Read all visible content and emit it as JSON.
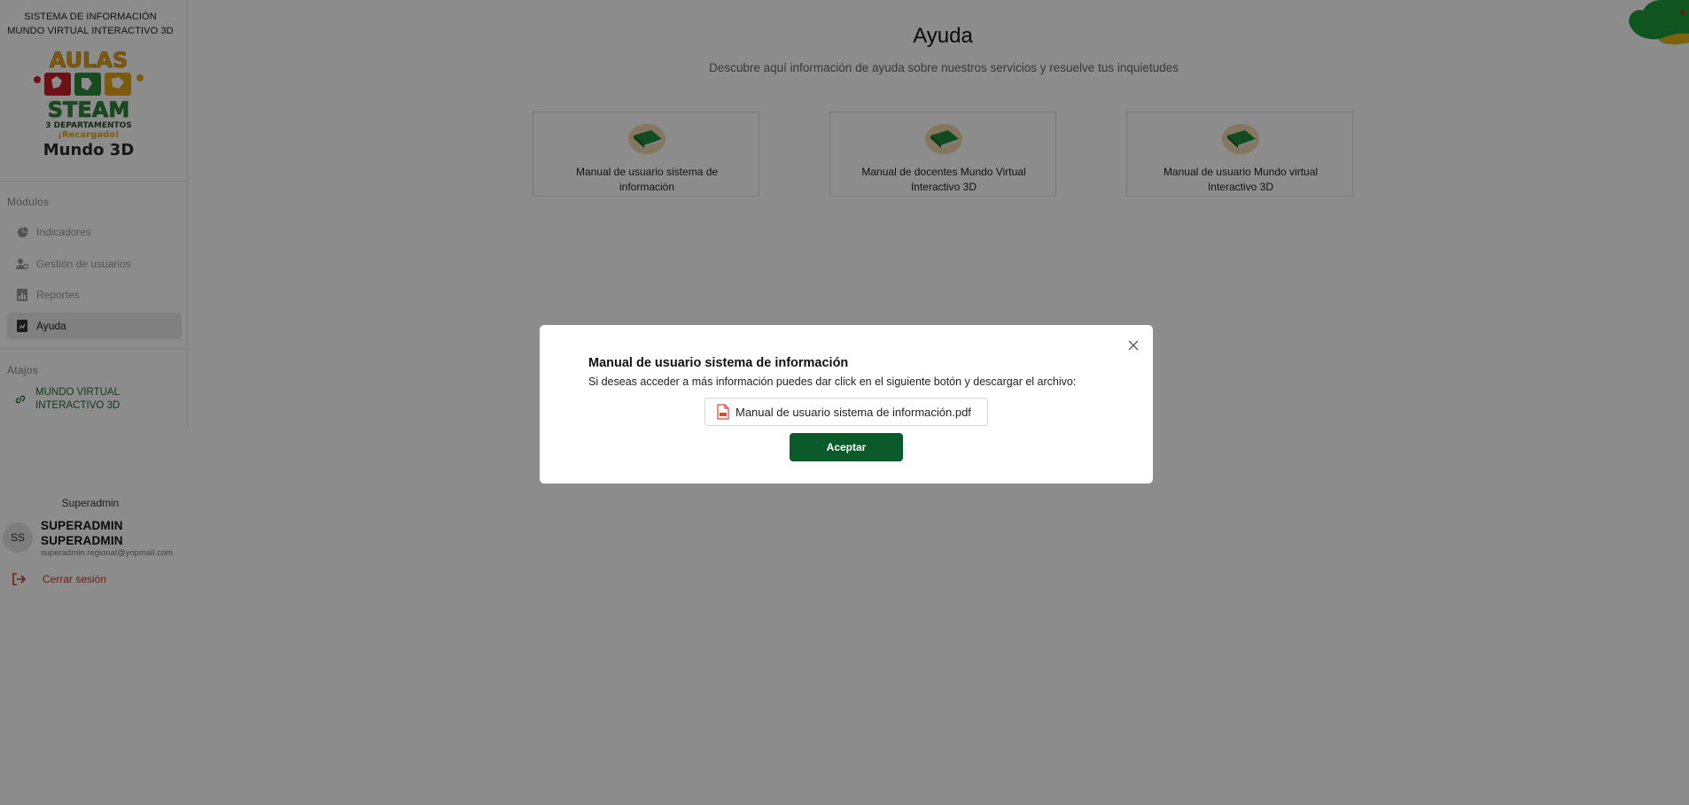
{
  "sidebar": {
    "system_title_line1": "SISTEMA DE INFORMACIÓN",
    "system_title_line2": "MUNDO VIRTUAL INTERACTIVO 3D",
    "logo": {
      "line1": "AULAS",
      "line2": "STEAM",
      "line3": "3 DEPARTAMENTOS",
      "line4": "¡Recargado!",
      "line5": "Mundo 3D"
    },
    "modules_label": "Módulos",
    "items": [
      {
        "label": "Indicadores",
        "icon": "pie-chart-icon"
      },
      {
        "label": "Gestión de usuarios",
        "icon": "users-icon"
      },
      {
        "label": "Reportes",
        "icon": "report-icon"
      },
      {
        "label": "Ayuda",
        "icon": "help-book-icon",
        "active": true
      }
    ],
    "shortcuts_label": "Atajos",
    "shortcut": {
      "line1": "MUNDO VIRTUAL",
      "line2": "INTERACTIVO 3D",
      "icon": "link-icon"
    }
  },
  "user": {
    "role": "Superadmin",
    "initials": "SS",
    "name_line1": "SUPERADMIN",
    "name_line2": "SUPERADMIN",
    "email": "superadmin.regional@yopmail.com",
    "logout_label": "Cerrar sesión"
  },
  "main": {
    "title": "Ayuda",
    "subtitle": "Descubre aquí información de ayuda sobre nuestros servicios y resuelve tus inquietudes",
    "cards": [
      {
        "line1": "Manual de usuario sistema de",
        "line2": "información",
        "icon": "book-icon"
      },
      {
        "line1": "Manual de docentes Mundo Virtual",
        "line2": "Interactivo 3D",
        "icon": "book-icon"
      },
      {
        "line1": "Manual de usuario Mundo virtual",
        "line2": "Interactivo 3D",
        "icon": "book-icon"
      }
    ]
  },
  "modal": {
    "title": "Manual de usuario sistema de información",
    "text": "Si deseas acceder a más información puedes dar click en el siguiente botón y descargar el archivo:",
    "file_name": "Manual de usuario sistema de información.pdf",
    "accept_label": "Aceptar"
  },
  "colors": {
    "brand_green": "#0a5a2a",
    "logout_red": "#c0392b",
    "overlay": "rgba(0,0,0,0.45)"
  }
}
